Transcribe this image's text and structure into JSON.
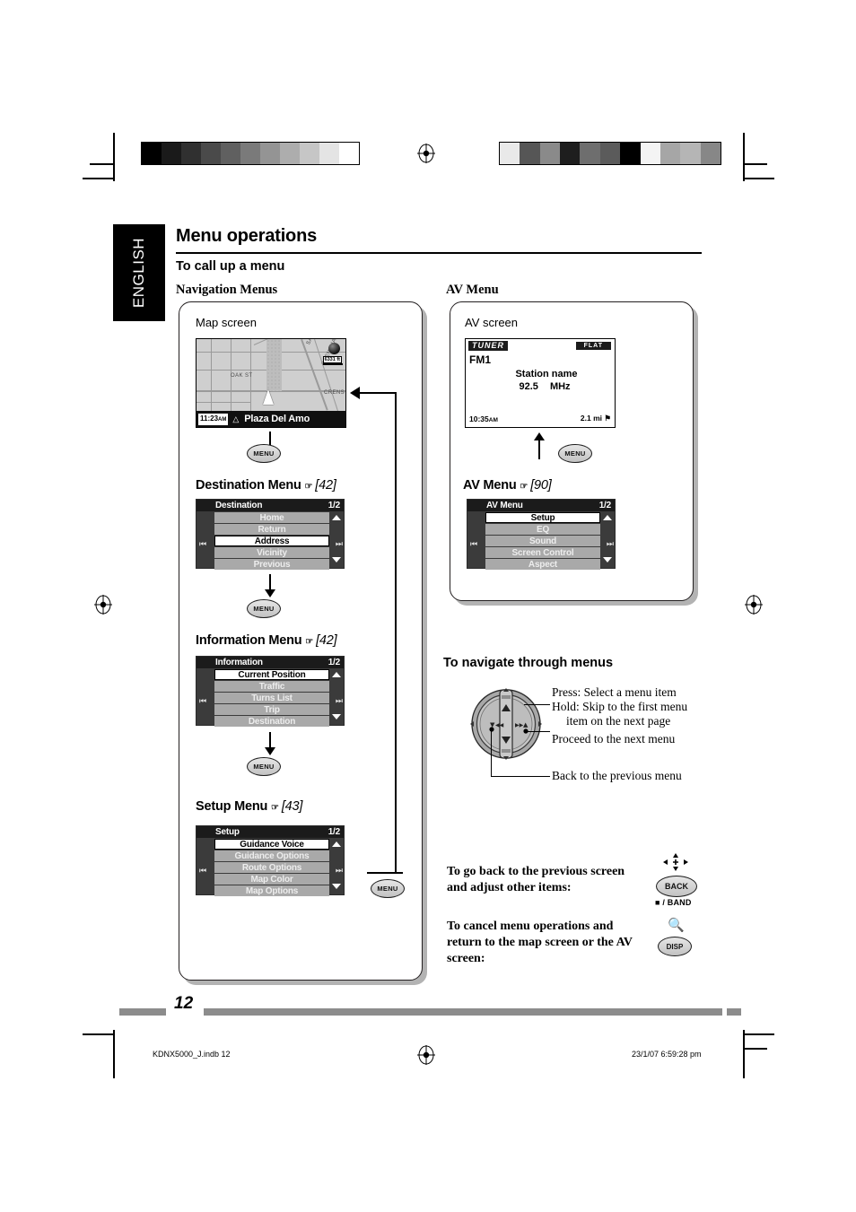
{
  "language_tab": "ENGLISH",
  "header": {
    "title": "Menu operations",
    "subtitle": "To call up a menu"
  },
  "left_column": {
    "section_label": "Navigation Menus",
    "screen_label": "Map screen",
    "map": {
      "time": "11:23",
      "time_suffix": "AM",
      "destination": "Plaza Del Amo",
      "scale": "6331 ft",
      "street_labels": [
        "OAK ST",
        "SANTA FE AVE",
        "CRENSHAW BLVD",
        "CRENS"
      ]
    },
    "menus": [
      {
        "button": "MENU",
        "caption": "Destination Menu",
        "page_ref": "[42]",
        "screen": {
          "title": "Destination",
          "page": "1/2",
          "items": [
            "Home",
            "Return",
            "Address",
            "Vicinity",
            "Previous"
          ],
          "selected_index": 2
        }
      },
      {
        "button": "MENU",
        "caption": "Information Menu",
        "page_ref": "[42]",
        "screen": {
          "title": "Information",
          "page": "1/2",
          "items": [
            "Current Position",
            "Traffic",
            "Turns List",
            "Trip",
            "Destination"
          ],
          "selected_index": 0
        }
      },
      {
        "button": "MENU",
        "caption": "Setup Menu",
        "page_ref": "[43]",
        "screen": {
          "title": "Setup",
          "page": "1/2",
          "items": [
            "Guidance Voice",
            "Guidance Options",
            "Route Options",
            "Map Color",
            "Map Options"
          ],
          "selected_index": 0
        }
      }
    ],
    "loop_button": "MENU"
  },
  "right_column": {
    "section_label": "AV Menu",
    "screen_label": "AV screen",
    "av": {
      "source": "TUNER",
      "eq": "FLAT",
      "band": "FM1",
      "station": "Station name",
      "frequency": "92.5",
      "frequency_unit": "MHz",
      "clock": "10:35",
      "clock_suffix": "AM",
      "distance": "2.1 mi"
    },
    "menu": {
      "button": "MENU",
      "caption": "AV Menu",
      "page_ref": "[90]",
      "screen": {
        "title": "AV Menu",
        "page": "1/2",
        "items": [
          "Setup",
          "EQ",
          "Sound",
          "Screen Control",
          "Aspect"
        ],
        "selected_index": 0
      }
    }
  },
  "navigate_section": {
    "heading": "To navigate through menus",
    "callouts": [
      "Press: Select a menu item",
      "Hold: Skip to the first menu",
      "item on the next page",
      "Proceed to the next menu",
      "Back to the previous menu"
    ]
  },
  "instructions": [
    {
      "text_lines": [
        "To go back to the previous screen",
        "and adjust other items:"
      ],
      "button": "BACK",
      "button_sub": "/ BAND",
      "icon": "dpad-icon"
    },
    {
      "text_lines": [
        "To cancel menu operations and",
        "return to the map screen or the AV",
        "screen:"
      ],
      "button": "DISP",
      "button_sub": "",
      "icon": "magnifier-icon"
    }
  ],
  "footer": {
    "page_number": "12",
    "file_name": "KDNX5000_J.indb   12",
    "timestamp": "23/1/07   6:59:28 pm"
  },
  "calibration": {
    "left_strip": [
      "#000000",
      "#1a1a1a",
      "#303030",
      "#4a4a4a",
      "#606060",
      "#7a7a7a",
      "#949494",
      "#adadad",
      "#c6c6c6",
      "#e4e4e4",
      "#ffffff"
    ],
    "right_strip": [
      "#e9e9e9",
      "#565656",
      "#8a8a8a",
      "#1e1e1e",
      "#6e6e6e",
      "#5b5b5b",
      "#000000",
      "#f4f4f4",
      "#a6a6a6",
      "#b5b5b5",
      "#878787"
    ]
  }
}
